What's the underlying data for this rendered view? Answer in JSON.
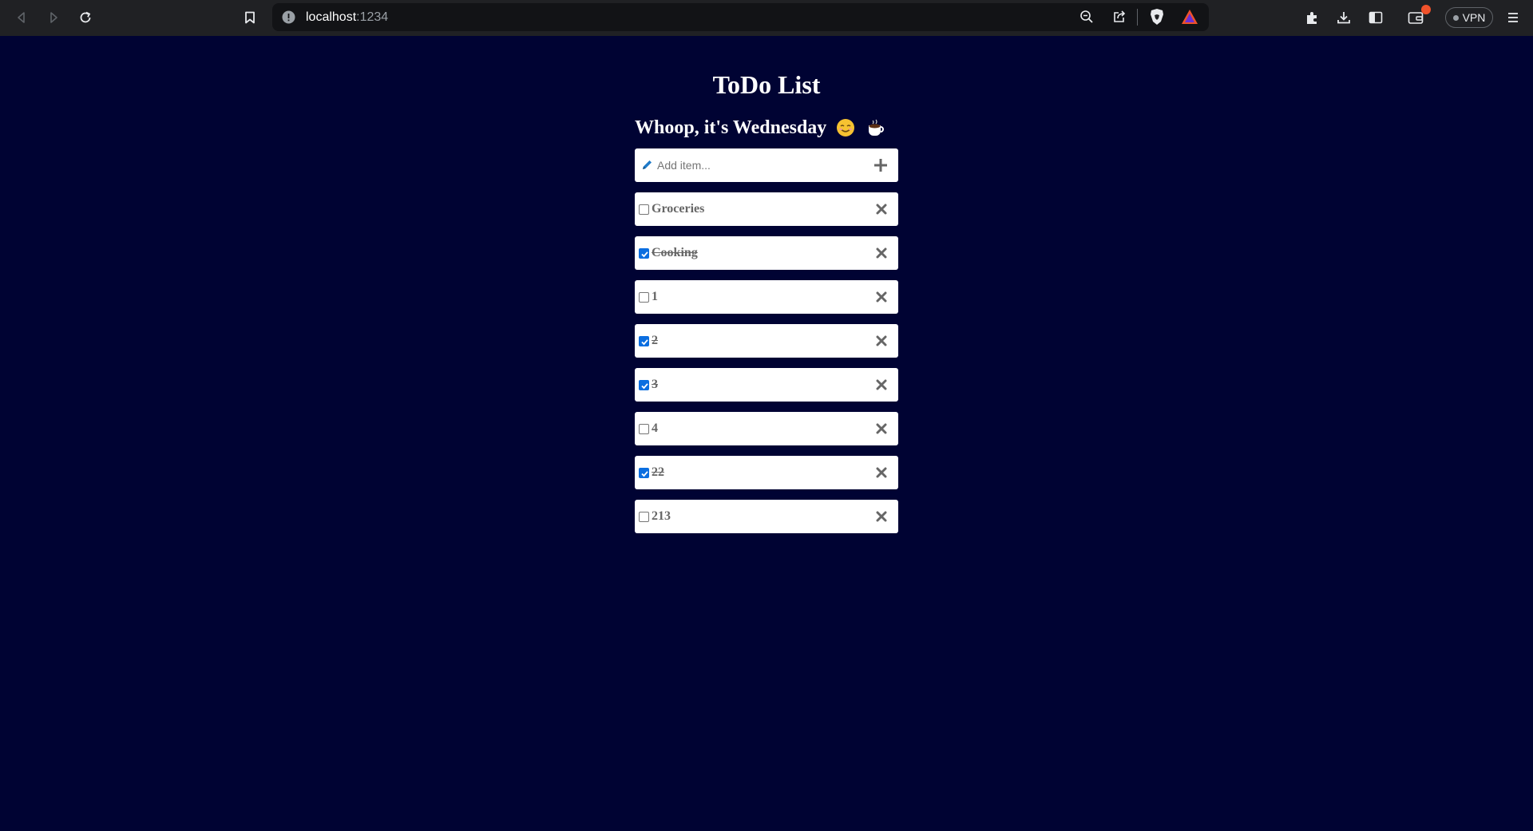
{
  "browser": {
    "url_host": "localhost",
    "url_port": ":1234",
    "vpn_label": "VPN"
  },
  "app": {
    "title": "ToDo List",
    "day_header": "Whoop, it's Wednesday",
    "add_placeholder": "Add item...",
    "icons": {
      "add_field": "pen-icon",
      "add_button": "plus-icon",
      "delete": "close-icon"
    }
  },
  "todos": [
    {
      "label": "Groceries",
      "done": false
    },
    {
      "label": "Cooking",
      "done": true
    },
    {
      "label": "1",
      "done": false
    },
    {
      "label": "2",
      "done": true
    },
    {
      "label": "3",
      "done": true
    },
    {
      "label": "4",
      "done": false
    },
    {
      "label": "22",
      "done": true
    },
    {
      "label": "213",
      "done": false
    }
  ],
  "colors": {
    "background": "#000333",
    "checkbox_checked": "#0b6ee0",
    "item_text": "#666666",
    "icon_gray": "#666666"
  }
}
